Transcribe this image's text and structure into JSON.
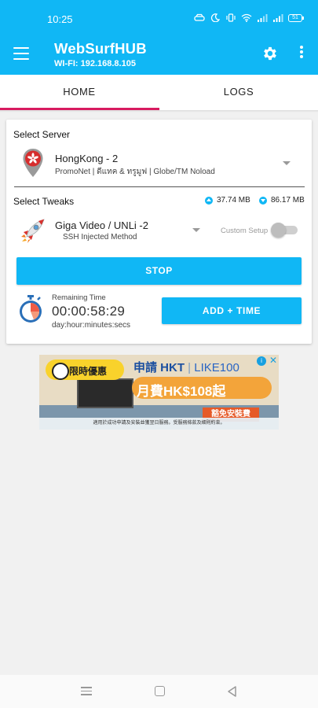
{
  "status_bar": {
    "time": "10:25",
    "battery": "51"
  },
  "app": {
    "title": "WebSurfHUB",
    "subtitle": "WI-FI: 192.168.8.105"
  },
  "tabs": [
    {
      "label": "HOME",
      "active": true
    },
    {
      "label": "LOGS",
      "active": false
    }
  ],
  "server": {
    "section_label": "Select Server",
    "name": "HongKong - 2",
    "description": "PromoNet | ดีแทค & ทรูมูฟ | Globe/TM Noload"
  },
  "tweaks": {
    "section_label": "Select Tweaks",
    "upload": "37.74 MB",
    "download": "86.17 MB",
    "name": "Giga Video / UNLi -2",
    "method": "SSH Injected Method",
    "custom_setup_label": "Custom Setup",
    "custom_setup_on": false
  },
  "actions": {
    "stop_label": "STOP",
    "add_time_label": "ADD + TIME"
  },
  "timer": {
    "label": "Remaining Time",
    "value": "00:00:58:29",
    "format": "day:hour:minutes:secs"
  },
  "ad": {
    "badge": "限時優惠",
    "brand": "申請 HKT",
    "brand_partner": "LIKE100",
    "price": "月費HK$108起",
    "cta": "豁免安裝費",
    "fine_print": "適用於成功申請及安裝並獲翌日服務。受服務條款及細則約束。"
  },
  "colors": {
    "primary": "#10b7f5",
    "tab_indicator": "#d81b60",
    "background": "#f1f1f1"
  }
}
